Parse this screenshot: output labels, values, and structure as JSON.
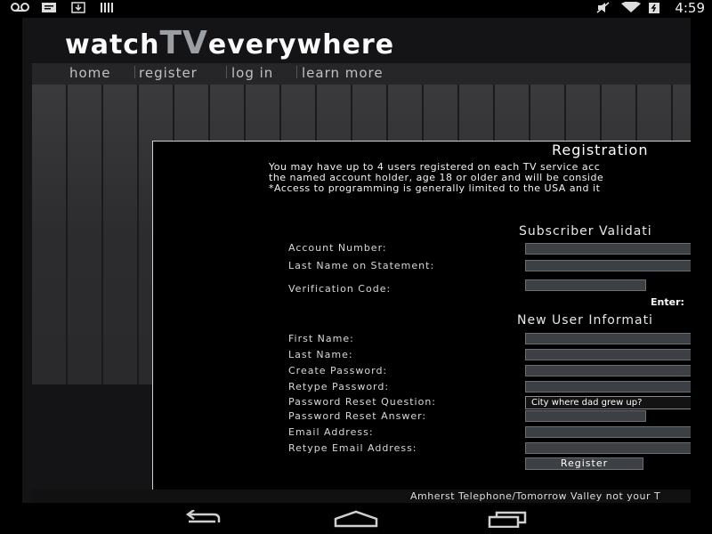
{
  "status_bar": {
    "time": "4:59",
    "left_icons": [
      "voicemail-icon",
      "chat-icon",
      "download-icon",
      "barcode-icon"
    ],
    "right_icons": [
      "mute-icon",
      "wifi-icon",
      "battery-icon"
    ]
  },
  "brand": {
    "part1": "watch",
    "part2": "TV",
    "part3": "everywhere"
  },
  "nav": {
    "items": [
      "home",
      "register",
      "log in",
      "learn more"
    ]
  },
  "registration": {
    "title": "Registration",
    "intro": [
      "You may have up to 4 users registered on each TV service acc",
      "the named account holder, age 18 or older and will be conside",
      "*Access to programming is generally limited to the USA and it"
    ],
    "subscriber_section": "Subscriber Validati",
    "account_number_label": "Account Number:",
    "last_name_statement_label": "Last Name on Statement:",
    "verification_code_label": "Verification Code:",
    "enter_label": "Enter:",
    "new_user_section": "New User Informati",
    "first_name_label": "First Name:",
    "last_name_label": "Last Name:",
    "create_password_label": "Create Password:",
    "retype_password_label": "Retype Password:",
    "reset_question_label": "Password Reset Question:",
    "reset_question_value": "City where dad grew up?",
    "reset_answer_label": "Password Reset Answer:",
    "email_label": "Email Address:",
    "retype_email_label": "Retype Email Address:",
    "register_button": "Register"
  },
  "footer": {
    "text": "Amherst Telephone/Tomorrow Valley not your T"
  },
  "colors": {
    "accent_tv": "#9b9ea3",
    "field_bg": "#3c3f44",
    "panel_bg": "#000000"
  }
}
